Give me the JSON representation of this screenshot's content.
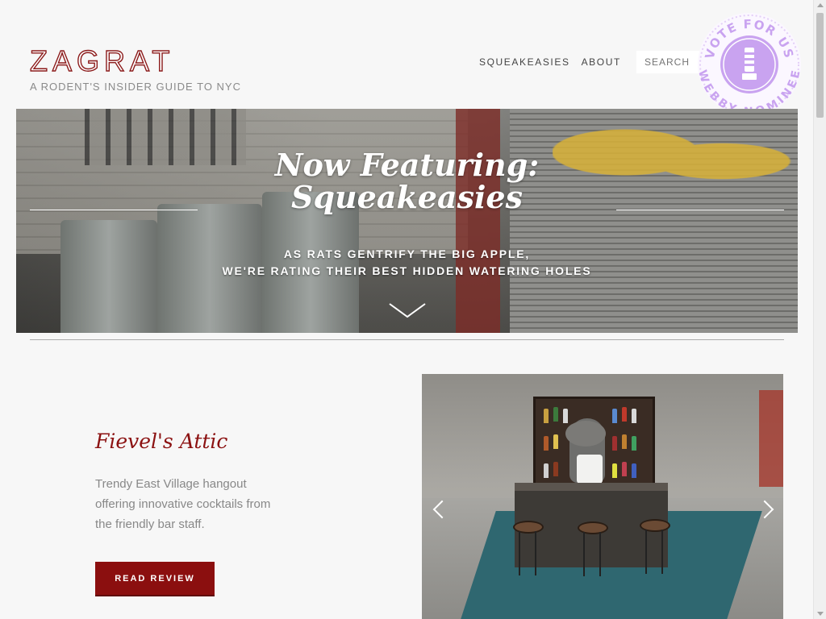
{
  "header": {
    "logo": "ZAGRAT",
    "tagline": "A RODENT'S INSIDER GUIDE TO NYC",
    "nav": [
      "SQUEAKEASIES",
      "ABOUT"
    ],
    "search_placeholder": "SEARCH"
  },
  "badge": {
    "top_text": "VOTE FOR US",
    "bottom_text": "WEBBY NOMINEE",
    "color": "#c9a3f0",
    "icon": "webby-trophy-icon"
  },
  "hero": {
    "title_line1": "Now Featuring:",
    "title_line2": "Squeakeasies",
    "sub_line1": "AS RATS GENTRIFY THE BIG APPLE,",
    "sub_line2": "WE'RE RATING THEIR BEST HIDDEN WATERING HOLES",
    "scroll_icon": "chevron-down-icon"
  },
  "feature": {
    "title": "Fievel's Attic",
    "description": "Trendy East Village hangout offering innovative cocktails from the friendly bar staff.",
    "button_label": "READ REVIEW",
    "prev_icon": "chevron-left-icon",
    "next_icon": "chevron-right-icon"
  },
  "colors": {
    "brand": "#8b1a1a",
    "button": "#8b0f0f",
    "background": "#f7f7f7"
  }
}
